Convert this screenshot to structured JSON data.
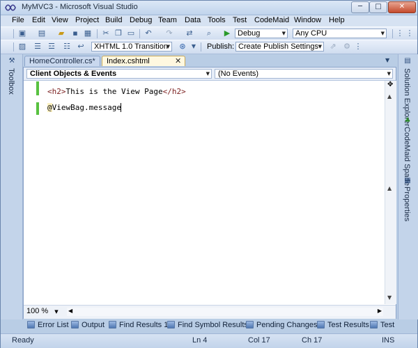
{
  "window": {
    "title": "MyMVC3 - Microsoft Visual Studio",
    "min_glyph": "─",
    "max_glyph": "□",
    "close_glyph": "✕"
  },
  "menu": [
    "File",
    "Edit",
    "View",
    "Project",
    "Build",
    "Debug",
    "Team",
    "Data",
    "Tools",
    "Test",
    "CodeMaid",
    "Window",
    "Help"
  ],
  "toolbar1": {
    "config_combo": "Debug",
    "platform_combo": "Any CPU",
    "icons": [
      "new-project-icon",
      "add-item-icon",
      "open-file-icon",
      "save-icon",
      "save-all-icon",
      "cut-icon",
      "copy-icon",
      "paste-icon",
      "undo-icon",
      "redo-icon",
      "navigate-icon",
      "start-debug-icon",
      "find-icon"
    ]
  },
  "toolbar2": {
    "doctype_combo": "XHTML 1.0 Transition",
    "publish_label": "Publish:",
    "publish_combo": "Create Publish Settings"
  },
  "left_strip": {
    "toolbox_label": "Toolbox"
  },
  "right_strip": {
    "solution_explorer_label": "Solution Explorer",
    "codemaid_label": "CodeMaid Spade",
    "properties_label": "Properties"
  },
  "tabs": {
    "inactive": "HomeController.cs*",
    "active": "Index.cshtml",
    "close_glyph": "✕",
    "overflow_glyph": "▼"
  },
  "editor": {
    "objects_combo": "Client Objects & Events",
    "events_combo": "(No Events)",
    "line1_open": "<h2>",
    "line1_text": "This is the View Page",
    "line1_close": "</h2>",
    "line2_at": "@",
    "line2_text": "ViewBag.message",
    "zoom": "100 %"
  },
  "tool_tabs": [
    "Error List",
    "Output",
    "Find Results 1",
    "Find Symbol Results",
    "Pending Changes",
    "Test Results",
    "Test"
  ],
  "status": {
    "state": "Ready",
    "line": "Ln 4",
    "col": "Col 17",
    "ch": "Ch 17",
    "mode": "INS"
  }
}
